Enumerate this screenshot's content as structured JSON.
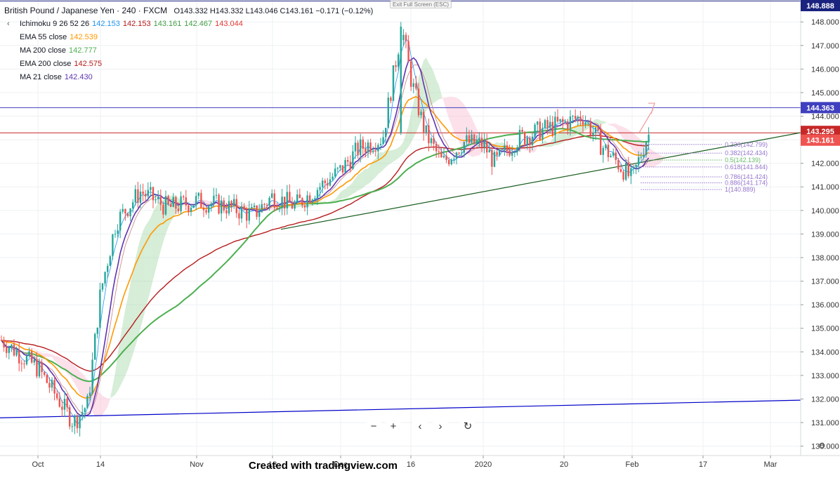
{
  "header": {
    "title": "British Pound / Japanese Yen · 240 · FXCM",
    "ohlc": "O143.332  H143.332  L143.046  C143.161  −0.171 (−0.12%)"
  },
  "indicators": [
    {
      "label": "Ichimoku 9 26 52 26",
      "values": [
        {
          "text": "142.153",
          "color": "#2196f3"
        },
        {
          "text": "142.153",
          "color": "#b71c1c"
        },
        {
          "text": "143.161",
          "color": "#43a047"
        },
        {
          "text": "142.467",
          "color": "#43a047"
        },
        {
          "text": "143.044",
          "color": "#e53935"
        }
      ]
    },
    {
      "label": "EMA 55 close",
      "values": [
        {
          "text": "142.539",
          "color": "#ff9800"
        }
      ]
    },
    {
      "label": "MA 200 close",
      "values": [
        {
          "text": "142.777",
          "color": "#4caf50"
        }
      ]
    },
    {
      "label": "EMA 200 close",
      "values": [
        {
          "text": "142.575",
          "color": "#b71c1c"
        }
      ]
    },
    {
      "label": "MA 21 close",
      "values": [
        {
          "text": "142.430",
          "color": "#5e35b1"
        }
      ]
    }
  ],
  "toolbar": {
    "exit_fullscreen": "Exit Full Screen (ESC)"
  },
  "nav": {
    "zoom_out": "−",
    "zoom_in": "+",
    "left": "‹",
    "right": "›",
    "reset": "↻"
  },
  "footer": {
    "text": "Created with tradingview.com"
  },
  "colors": {
    "up": "#26a69a",
    "down": "#ef5350",
    "ema55": "#ff9800",
    "ma200": "#4caf50",
    "ema200": "#b71c1c",
    "ma21": "#5e35b1",
    "tenkan": "#2196f3",
    "kijun": "#b71c1c",
    "cloud_bull": "#a5d6a7",
    "cloud_bear": "#f8bbd0",
    "hline_blue": "#3f3fbf",
    "hline_red": "#c62828",
    "trend_green": "#1b5e20",
    "trend_blue": "#0000c8"
  },
  "chart_data": {
    "type": "candlestick",
    "y_axis": {
      "ticks": [
        "148.000",
        "147.000",
        "146.000",
        "145.000",
        "144.000",
        "143.000",
        "142.000",
        "141.000",
        "140.000",
        "139.000",
        "138.000",
        "137.000",
        "136.000",
        "135.000",
        "134.000",
        "133.000",
        "132.000",
        "131.000",
        "130.000"
      ],
      "range": [
        129.6,
        148.9
      ]
    },
    "x_axis": {
      "ticks": [
        "Oct",
        "14",
        "Nov",
        "18",
        "Dec",
        "16",
        "2020",
        "20",
        "Feb",
        "17",
        "Mar"
      ]
    },
    "price_labels": [
      {
        "text": "148.888",
        "value": 148.888,
        "color": "#1a237e"
      },
      {
        "text": "144.363",
        "value": 144.363,
        "color": "#3f3fbf"
      },
      {
        "text": "143.295",
        "value": 143.295,
        "color": "#c62828"
      },
      {
        "text": "143.161",
        "value": 143.161,
        "color": "#ef5350"
      }
    ],
    "fibonacci": [
      {
        "text": "0.236(142.799)",
        "value": 142.799,
        "color": "#9575cd"
      },
      {
        "text": "0.382(142.434)",
        "value": 142.434,
        "color": "#9575cd"
      },
      {
        "text": "0.5(142.139)",
        "value": 142.139,
        "color": "#66bb6a"
      },
      {
        "text": "0.618(141.844)",
        "value": 141.844,
        "color": "#9575cd"
      },
      {
        "text": "0.786(141.424)",
        "value": 141.424,
        "color": "#9575cd"
      },
      {
        "text": "0.886(141.174)",
        "value": 141.174,
        "color": "#9575cd"
      },
      {
        "text": "1(140.889)",
        "value": 140.889,
        "color": "#9575cd"
      }
    ],
    "horizontal_lines": [
      {
        "value": 148.888,
        "color": "#1a237e"
      },
      {
        "value": 144.363,
        "color": "#3f3fbf"
      },
      {
        "value": 143.295,
        "color": "#c62828"
      }
    ],
    "trendlines": [
      {
        "from": [
          "Oct",
          "131.2"
        ],
        "to": [
          "Mar",
          "131.95"
        ],
        "color": "#0000c8"
      },
      {
        "from": [
          "Nov",
          "139.2"
        ],
        "to": [
          "Mar",
          "143.3"
        ],
        "color": "#1b5e20"
      }
    ],
    "close_path": [
      [
        "Sep 26",
        134.5
      ],
      [
        "Oct",
        133.3
      ],
      [
        "Oct 4",
        132.4
      ],
      [
        "Oct 8",
        131.0
      ],
      [
        "Oct 11",
        131.8
      ],
      [
        "Oct 14",
        136.5
      ],
      [
        "Oct 17",
        139.5
      ],
      [
        "Oct 21",
        140.8
      ],
      [
        "Oct 25",
        140.1
      ],
      [
        "Nov",
        140.4
      ],
      [
        "Nov 8",
        140.2
      ],
      [
        "Nov 14",
        139.8
      ],
      [
        "Nov 18",
        140.6
      ],
      [
        "Nov 22",
        140.2
      ],
      [
        "Nov 26",
        140.9
      ],
      [
        "Dec",
        141.7
      ],
      [
        "Dec 6",
        142.6
      ],
      [
        "Dec 10",
        143.1
      ],
      [
        "Dec 13",
        147.8
      ],
      [
        "Dec 16",
        145.6
      ],
      [
        "Dec 19",
        143.3
      ],
      [
        "Dec 23",
        142.0
      ],
      [
        "Dec 27",
        142.9
      ],
      [
        "2020",
        142.8
      ],
      [
        "Jan 7",
        142.0
      ],
      [
        "Jan 11",
        143.0
      ],
      [
        "Jan 16",
        143.4
      ],
      [
        "Jan 20",
        143.7
      ],
      [
        "Jan 24",
        144.0
      ],
      [
        "Jan 27",
        142.8
      ],
      [
        "Jan 31",
        142.0
      ],
      [
        "Feb",
        141.3
      ],
      [
        "Feb 4",
        143.2
      ]
    ]
  }
}
